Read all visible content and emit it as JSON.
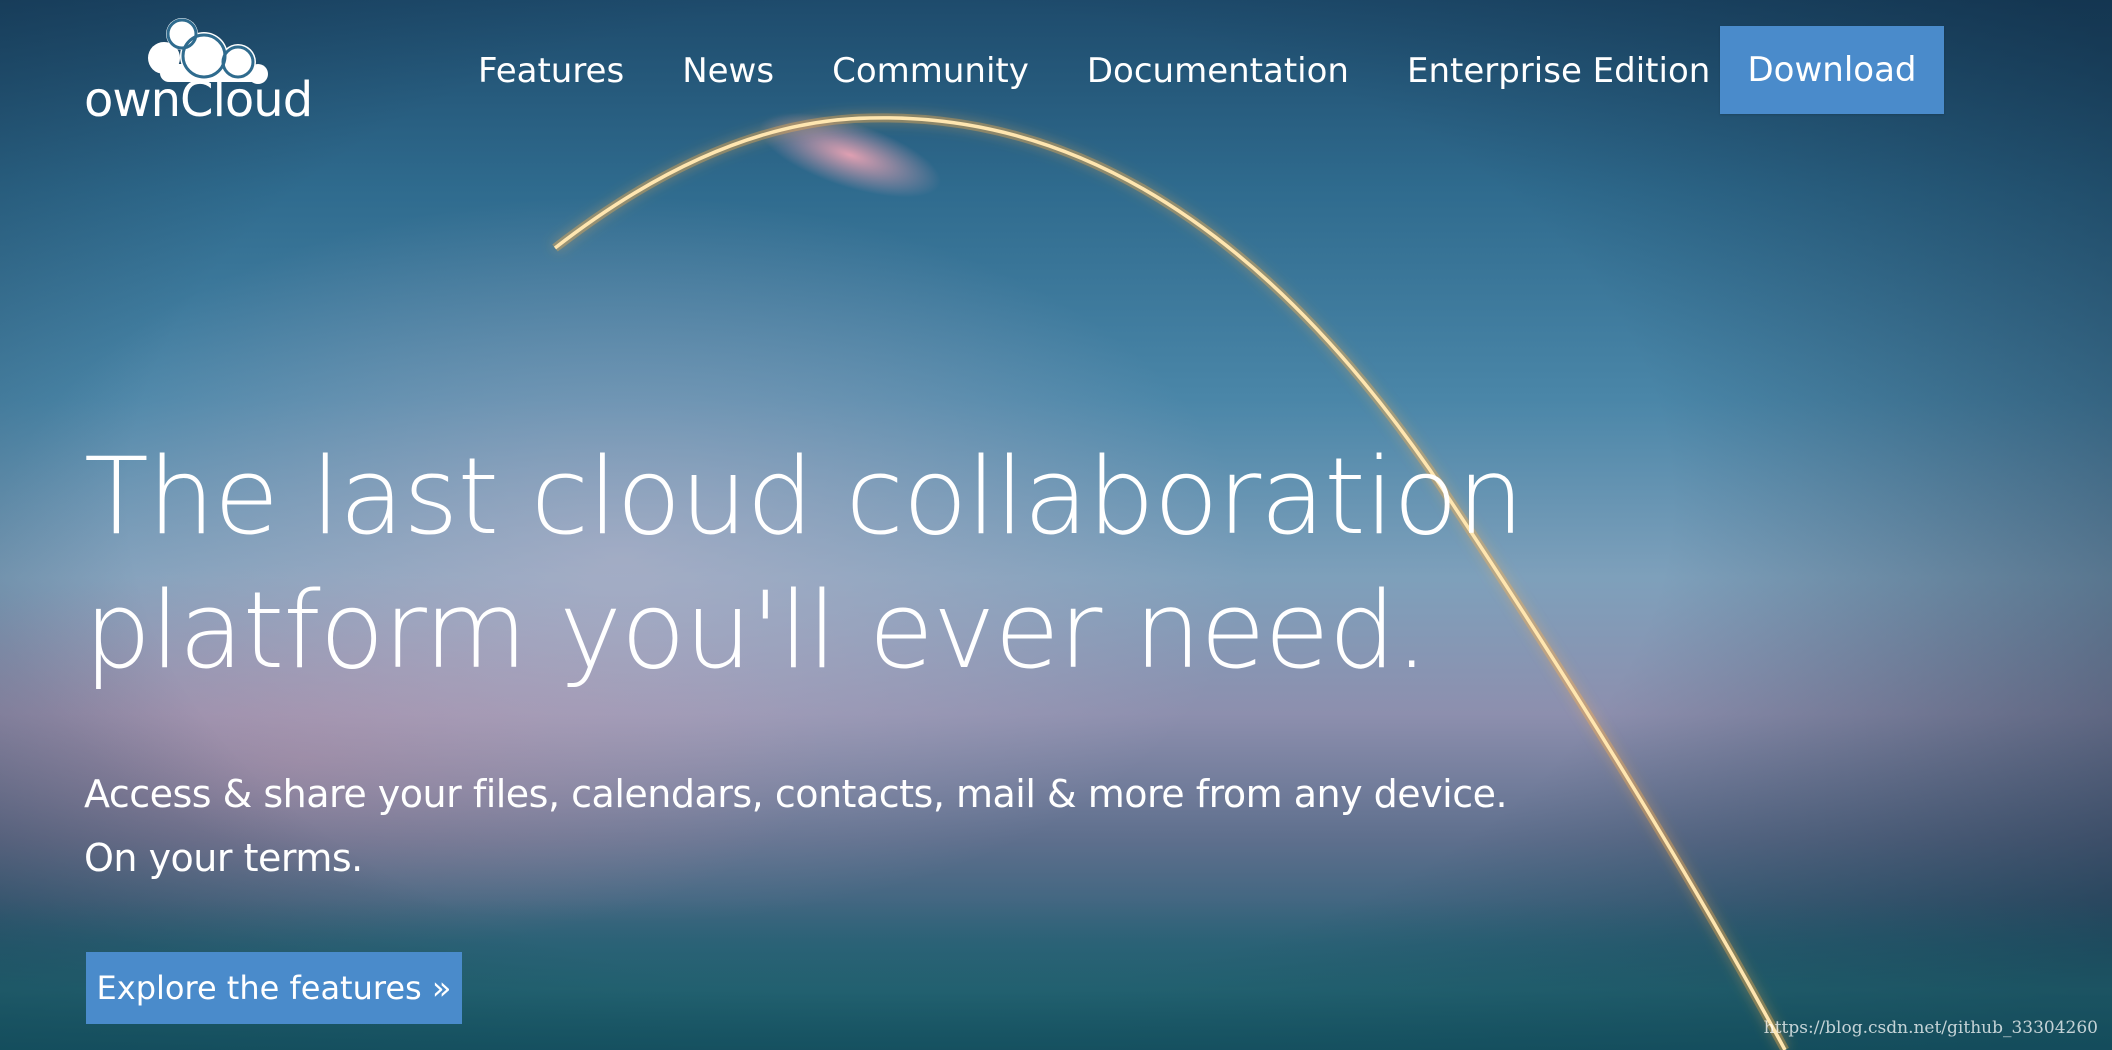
{
  "brand": {
    "name": "ownCloud"
  },
  "nav": {
    "items": [
      {
        "label": "Features"
      },
      {
        "label": "News"
      },
      {
        "label": "Community"
      },
      {
        "label": "Documentation"
      },
      {
        "label": "Enterprise Edition"
      }
    ],
    "download_label": "Download"
  },
  "hero": {
    "title_line1": "The last cloud collaboration",
    "title_line2": "platform you'll ever need.",
    "subtitle_line1": "Access & share your files, calendars, contacts, mail & more from any device.",
    "subtitle_line2": "On your terms.",
    "cta_label": "Explore the features »"
  },
  "watermark": "https://blog.csdn.net/github_33304260",
  "colors": {
    "accent": "#4a8bcb",
    "sky_top": "#1e4b6c",
    "sky_mid": "#7ea0bb",
    "trail": "#ffd27a"
  },
  "icons": {
    "logo": "cloud-icon"
  }
}
